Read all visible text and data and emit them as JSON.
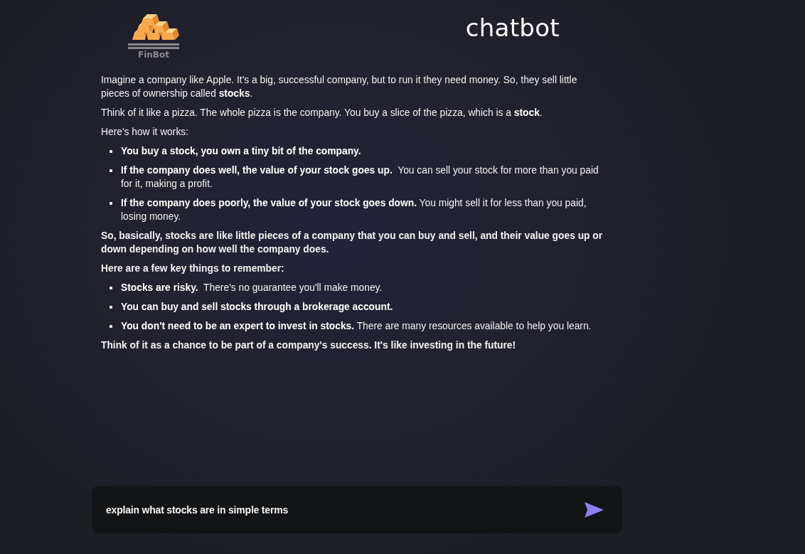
{
  "header": {
    "logo": {
      "label": "FinBot"
    },
    "title": "chatbot"
  },
  "response": {
    "blocks": [
      {
        "kind": "paragraph",
        "bold": false,
        "text": "Imagine a company like Apple. It's a big, successful company, but to run it they need money. So, they sell little pieces of ownership called **stocks**."
      },
      {
        "kind": "paragraph",
        "bold": false,
        "text": "Think of it like a pizza. The whole pizza is the company. You buy a slice of the pizza, which is a **stock**."
      },
      {
        "kind": "paragraph",
        "bold": false,
        "text": "Here's how it works:"
      },
      {
        "kind": "list",
        "items": [
          "**You buy a stock, you own a tiny bit of the company.**",
          "**If the company does well, the value of your stock goes up.**  You can sell your stock for more than you paid for it, making a profit.",
          "**If the company does poorly, the value of your stock goes down.** You might sell it for less than you paid, losing money."
        ]
      },
      {
        "kind": "paragraph",
        "bold": true,
        "text": "So, basically, stocks are like little pieces of a company that you can buy and sell, and their value goes up or down depending on how well the company does."
      },
      {
        "kind": "paragraph",
        "bold": true,
        "text": "Here are a few key things to remember:"
      },
      {
        "kind": "list",
        "items": [
          "**Stocks are risky.**  There's no guarantee you'll make money.",
          "**You can buy and sell stocks through a brokerage account.**",
          "**You don't need to be an expert to invest in stocks.** There are many resources available to help you learn."
        ]
      },
      {
        "kind": "paragraph",
        "bold": true,
        "text": "Think of it as a chance to be part of a company's success. It's like investing in the future!"
      }
    ]
  },
  "composer": {
    "value": "explain what stocks are in simple terms"
  }
}
